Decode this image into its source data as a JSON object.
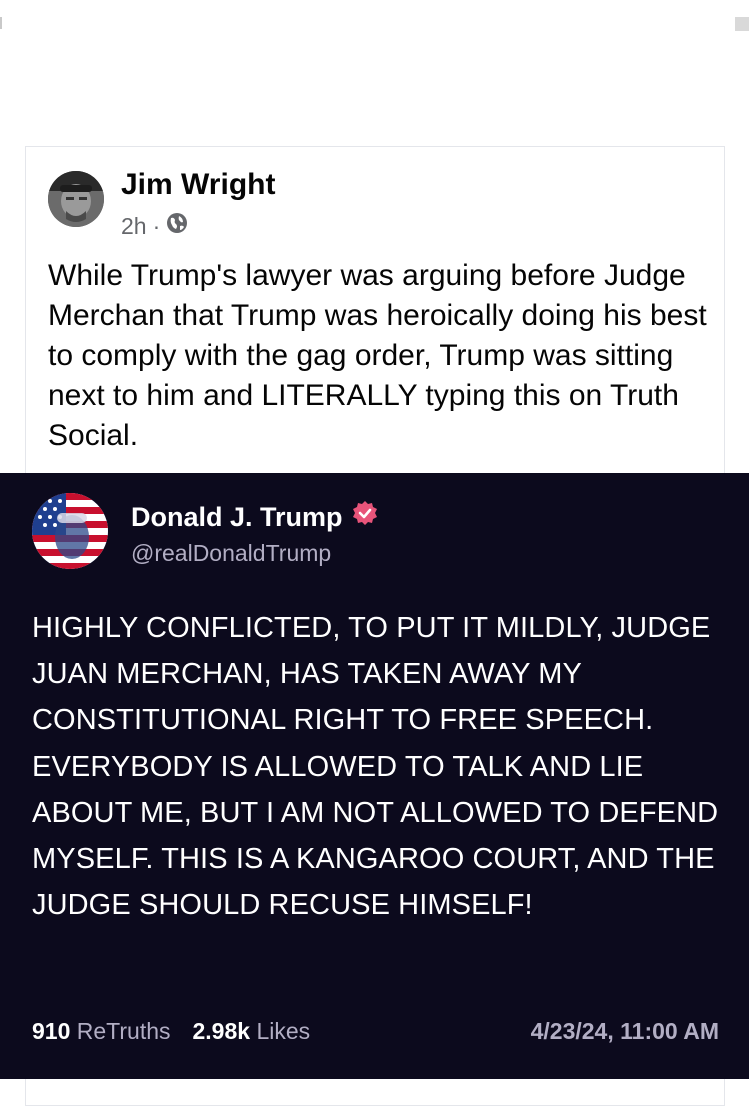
{
  "post": {
    "author": "Jim Wright",
    "time": "2h",
    "separator": "·",
    "privacy_icon": "globe-icon",
    "text": "While Trump's lawyer was arguing before Judge Merchan that Trump was heroically doing his best to comply with the gag order, Trump was sitting next to him and LITERALLY typing this on Truth Social."
  },
  "truth": {
    "name": "Donald J. Trump",
    "verified_icon": "verified-badge-icon",
    "handle": "@realDonaldTrump",
    "text": "HIGHLY CONFLICTED, TO PUT IT MILDLY, JUDGE JUAN MERCHAN, HAS TAKEN AWAY MY CONSTITUTIONAL RIGHT TO FREE SPEECH. EVERYBODY IS ALLOWED TO TALK AND LIE ABOUT ME, BUT I AM NOT ALLOWED TO DEFEND MYSELF. THIS IS A KANGAROO COURT, AND THE JUDGE SHOULD RECUSE HIMSELF!",
    "retruths_count": "910",
    "retruths_label": "ReTruths",
    "likes_count": "2.98k",
    "likes_label": "Likes",
    "date": "4/23/24, 11:00 AM"
  },
  "colors": {
    "truth_background": "#0c0a1d",
    "verified_badge": "#e8547a",
    "muted_text": "#b2aec4"
  }
}
